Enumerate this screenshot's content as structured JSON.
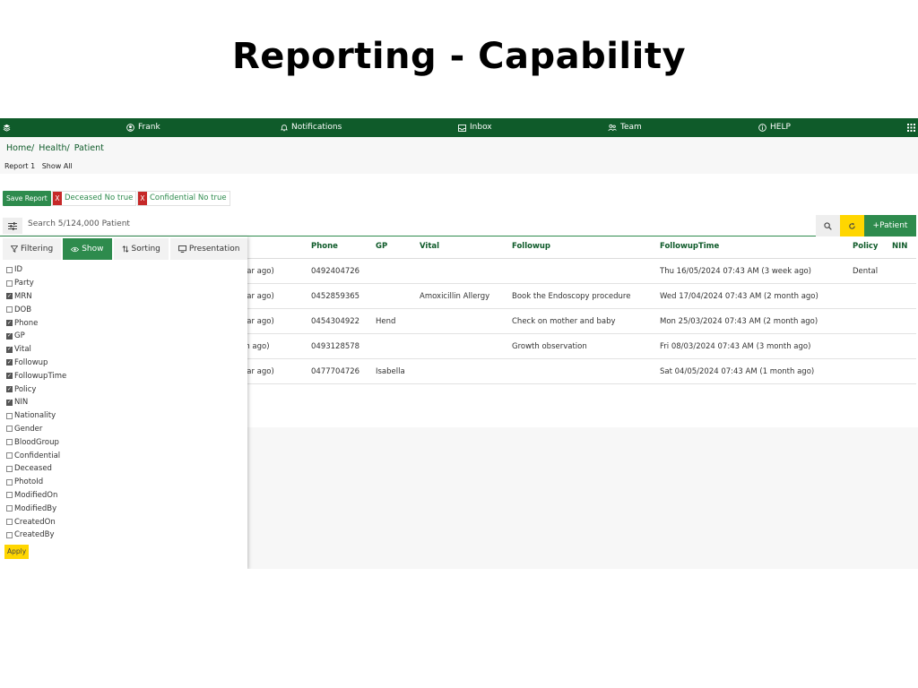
{
  "slide_title": "Reporting - Capability",
  "nav": {
    "user": "Frank",
    "notifications": "Notifications",
    "inbox": "Inbox",
    "team": "Team",
    "help": "HELP"
  },
  "breadcrumb": [
    "Home/",
    "Health/",
    "Patient"
  ],
  "report_bar": [
    "Report 1",
    "Show All"
  ],
  "save_report": "Save Report",
  "filters": [
    {
      "x": "X",
      "label": "Deceased No true"
    },
    {
      "x": "X",
      "label": "Confidential No true"
    }
  ],
  "search": {
    "text": "Search 5/124,000 Patient"
  },
  "add_patient": "+Patient",
  "table": {
    "headers": [
      "Phone",
      "GP",
      "Vital",
      "Followup",
      "FollowupTime",
      "Policy",
      "NIN"
    ],
    "rows": [
      {
        "tail": "ear ago)",
        "phone": "0492404726",
        "gp": "",
        "vital": "",
        "followup": "",
        "followup_time": "Thu 16/05/2024 07:43 AM (3 week ago)",
        "policy": "Dental",
        "nin": ""
      },
      {
        "tail": "ear ago)",
        "phone": "0452859365",
        "gp": "",
        "vital": "Amoxicillin Allergy",
        "followup": "Book the Endoscopy procedure",
        "followup_time": "Wed 17/04/2024 07:43 AM (2 month ago)",
        "policy": "",
        "nin": ""
      },
      {
        "tail": "ear ago)",
        "phone": "0454304922",
        "gp": "Hend",
        "vital": "",
        "followup": "Check on mother and baby",
        "followup_time": "Mon 25/03/2024 07:43 AM (2 month ago)",
        "policy": "",
        "nin": ""
      },
      {
        "tail": "th ago)",
        "phone": "0493128578",
        "gp": "",
        "vital": "",
        "followup": "Growth observation",
        "followup_time": "Fri 08/03/2024 07:43 AM (3 month ago)",
        "policy": "",
        "nin": ""
      },
      {
        "tail": "ear ago)",
        "phone": "0477704726",
        "gp": "Isabella",
        "vital": "",
        "followup": "",
        "followup_time": "Sat 04/05/2024 07:43 AM (1 month ago)",
        "policy": "",
        "nin": ""
      }
    ]
  },
  "panel": {
    "tabs": [
      "Filtering",
      "Show",
      "Sorting",
      "Presentation"
    ],
    "active_tab": "Show",
    "columns": [
      {
        "label": "ID",
        "checked": false
      },
      {
        "label": "Party",
        "checked": false
      },
      {
        "label": "MRN",
        "checked": true
      },
      {
        "label": "DOB",
        "checked": false
      },
      {
        "label": "Phone",
        "checked": true
      },
      {
        "label": "GP",
        "checked": true
      },
      {
        "label": "Vital",
        "checked": true
      },
      {
        "label": "Followup",
        "checked": true
      },
      {
        "label": "FollowupTime",
        "checked": true
      },
      {
        "label": "Policy",
        "checked": true
      },
      {
        "label": "NIN",
        "checked": true
      },
      {
        "label": "Nationality",
        "checked": false
      },
      {
        "label": "Gender",
        "checked": false
      },
      {
        "label": "BloodGroup",
        "checked": false
      },
      {
        "label": "Confidential",
        "checked": false
      },
      {
        "label": "Deceased",
        "checked": false
      },
      {
        "label": "PhotoId",
        "checked": false
      },
      {
        "label": "ModifiedOn",
        "checked": false
      },
      {
        "label": "ModifiedBy",
        "checked": false
      },
      {
        "label": "CreatedOn",
        "checked": false
      },
      {
        "label": "CreatedBy",
        "checked": false
      }
    ],
    "apply": "Apply"
  },
  "colors": {
    "nav_bg": "#0f5b2a",
    "accent": "#2e8b4d",
    "yellow": "#ffd600",
    "danger": "#c62828"
  }
}
